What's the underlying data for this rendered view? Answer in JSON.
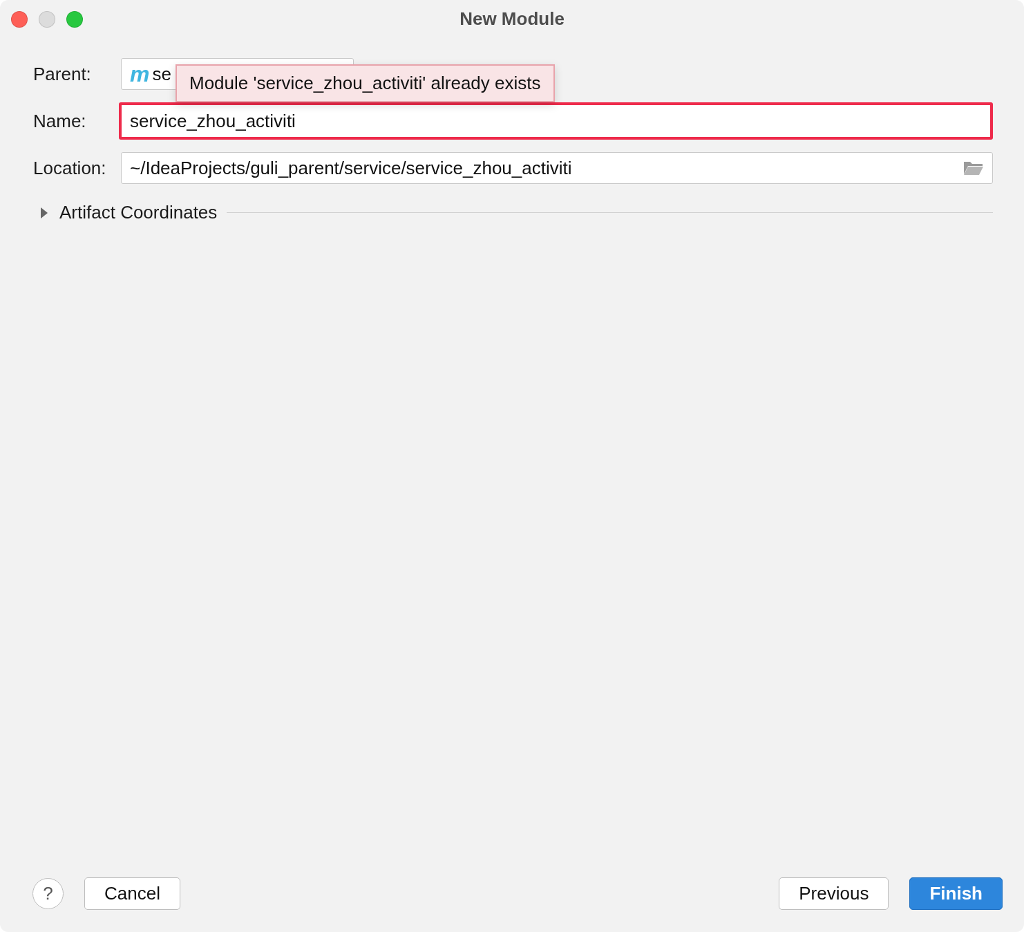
{
  "window": {
    "title": "New Module"
  },
  "form": {
    "parent": {
      "label": "Parent:",
      "badge": "m",
      "value": "se"
    },
    "name": {
      "label": "Name:",
      "value": "service_zhou_activiti",
      "error": true
    },
    "location": {
      "label": "Location:",
      "value": "~/IdeaProjects/guli_parent/service/service_zhou_activiti"
    }
  },
  "error_tooltip": "Module 'service_zhou_activiti' already exists",
  "artifact_coordinates": {
    "label": "Artifact Coordinates",
    "expanded": false
  },
  "buttons": [
    {
      "label": "?",
      "kind": "help"
    },
    {
      "label": "Cancel",
      "kind": "normal"
    },
    {
      "label": "Previous",
      "kind": "normal"
    },
    {
      "label": "Finish",
      "kind": "default"
    }
  ]
}
